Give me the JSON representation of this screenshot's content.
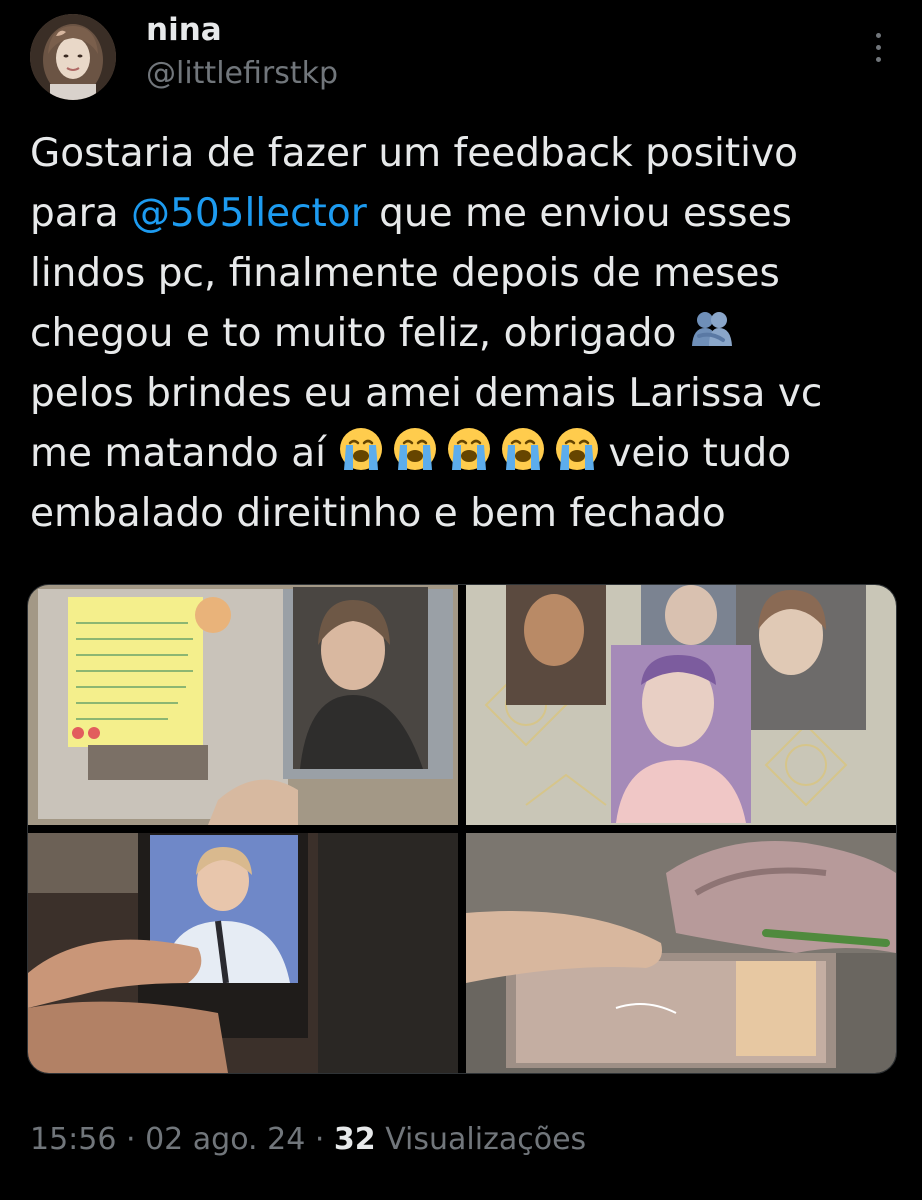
{
  "author": {
    "display_name": "nina",
    "handle": "@littlefirstkp",
    "avatar_icon": "avatar-photo"
  },
  "more_icon": "more-options-icon",
  "tweet": {
    "line1": "Gostaria de fazer um feedback positivo",
    "line2_pre": "para ",
    "mention": "@505llector",
    "line2_post": " que me enviou esses",
    "line3": "lindos pc, finalmente depois de meses",
    "line4": "chegou e to muito feliz, obrigado",
    "line4_emoji": "people-hugging-emoji",
    "line5": "pelos brindes eu amei demais Larissa vc",
    "line6_pre": "me matando aí ",
    "line6_emojis": [
      "loudly-crying-face-emoji",
      "loudly-crying-face-emoji",
      "loudly-crying-face-emoji",
      "loudly-crying-face-emoji",
      "loudly-crying-face-emoji"
    ],
    "line6_post": "veio tudo",
    "line7": "embalado direitinho e bem fechado"
  },
  "media": [
    {
      "name": "photocard-with-handwritten-note-photo"
    },
    {
      "name": "photocards-on-lace-tablecloth-photo"
    },
    {
      "name": "photocard-in-hand-photo"
    },
    {
      "name": "sealed-package-with-scissors-photo"
    }
  ],
  "meta": {
    "time": "15:56",
    "separator": " · ",
    "date": "02 ago. 24",
    "views_count": "32",
    "views_label": " Visualizações"
  },
  "colors": {
    "background": "#000000",
    "text": "#e7e9ea",
    "secondary_text": "#71767b",
    "link": "#1d9bf0"
  }
}
